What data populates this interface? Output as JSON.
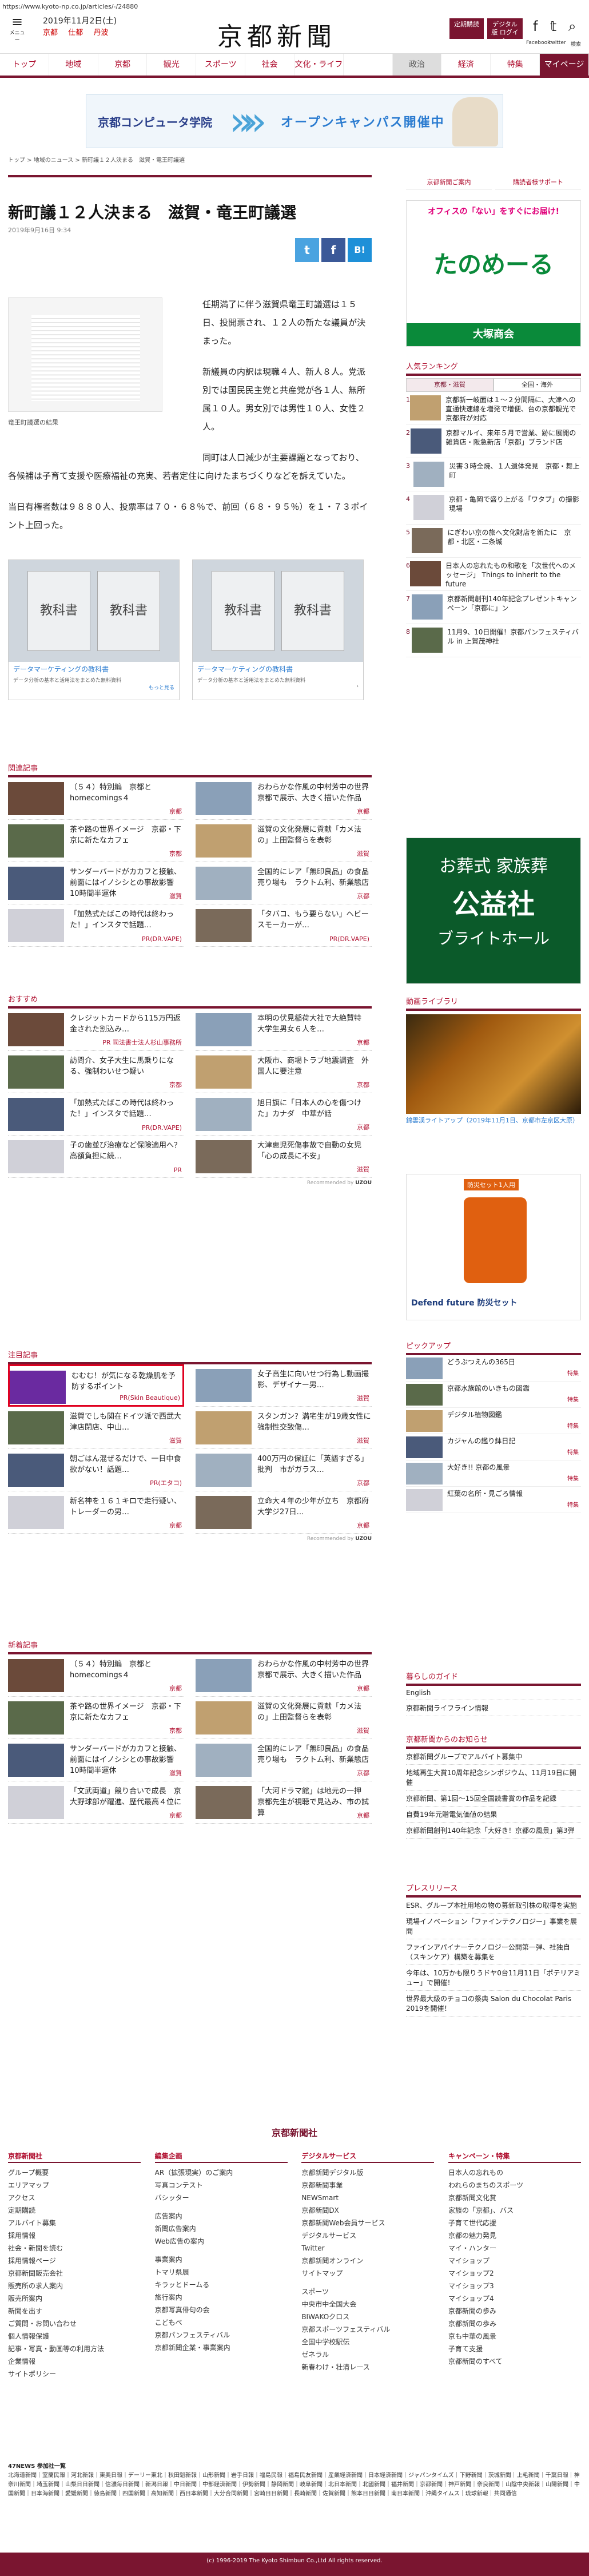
{
  "url": "https://www.kyoto-np.co.jp/articles/-/24880",
  "header": {
    "menu_label": "メニュー",
    "date": "2019年11月2日(土)",
    "weather": [
      "京都",
      "仕都",
      "丹波"
    ],
    "logo": "京都新聞",
    "btn_member": "定期購読",
    "btn_digital": "デジタル版 ログイン",
    "sns_fb": "Facebook",
    "sns_tw": "twitter",
    "sns_search": "検索"
  },
  "nav": [
    "トップ",
    "地域",
    "京都",
    "観光",
    "スポーツ",
    "社会",
    "文化・ライフ",
    "",
    "政治",
    "経済",
    "特集",
    "マイページ"
  ],
  "ad_top": {
    "school": "京都コンピュータ学院",
    "cta": "オープンキャンパス開催中"
  },
  "breadcrumb": "トップ > 地域のニュース > 新町議１２人決まる　滋賀・竜王町議選",
  "article": {
    "title": "新町議１２人決まる　滋賀・竜王町議選",
    "date": "2019年9月16日 9:34",
    "photo_caption": "竜王町議選の結果",
    "p1": "任期満了に伴う滋賀県竜王町議選は１５日、投開票され、１２人の新たな議員が決まった。",
    "p2": "新議員の内訳は現職４人、新人８人。党派別では国民民主党と共産党が各１人、無所属１０人。男女別では男性１０人、女性２人。",
    "p3": "同町は人口減少が主要課題となっており、各候補は子育て支援や医療福祉の充実、若者定住に向けたまちづくりなどを訴えていた。",
    "p4": "当日有権者数は９８８０人、投票率は７０・６８％で、前回（６８・９５％）を１・７３ポイント上回った。"
  },
  "share": {
    "tw": "t",
    "fb": "f",
    "b": "B!"
  },
  "ad_pair": [
    {
      "img": "教科書",
      "title": "データマーケティングの教科書",
      "desc": "データ分析の基本と活用法をまとめた無料資料",
      "more": "もっと見る"
    },
    {
      "img": "教科書",
      "title": "データマーケティングの教科書",
      "desc": "データ分析の基本と活用法をまとめた無料資料",
      "more": "›"
    }
  ],
  "related": {
    "heading": "関連記事",
    "items": [
      {
        "t": "（５４）特別編　京都とhomecomings４",
        "c": "京都"
      },
      {
        "t": "おわらかな作風の中村芳中の世界　京都で展示、大きく描いた作品",
        "c": "京都"
      },
      {
        "t": "茶や路の世界イメージ　京都・下京に新たなカフェ",
        "c": "京都"
      },
      {
        "t": "滋賀の文化発展に貢献「カメ法の」上田監督らを表彰",
        "c": "滋賀"
      },
      {
        "t": "サンダーバードがカカフと接触、前面にはイノシシとの事故影響　10時間半運休",
        "c": "滋賀"
      },
      {
        "t": "全国的にレア「無印良品」の食品売り場も　ラクトム利、新業態店",
        "c": "京都"
      },
      {
        "t": "「加熱式たばこの時代は終わった！」インスタで話題…",
        "c": "PR(DR.VAPE)"
      },
      {
        "t": "「タバコ、もう要らない」ヘビースモーカーが…",
        "c": "PR(DR.VAPE)"
      }
    ]
  },
  "recommend": {
    "heading": "おすすめ",
    "items": [
      {
        "t": "クレジットカードから115万円返金された割込み…",
        "c": "PR 司法書士法人杉山事務所"
      },
      {
        "t": "本明の伏見稲荷大社で大絶賛特　大学生男女６人を…",
        "c": "京都"
      },
      {
        "t": "訪問介、女子大生に馬乗りになる、強制わいせつ疑い",
        "c": "京都"
      },
      {
        "t": "大阪市、商場トラブ地震調査　外国人に要注意",
        "c": "京都"
      },
      {
        "t": "「加熱式たばこの時代は終わった！」インスタで話題…",
        "c": "PR(DR.VAPE)"
      },
      {
        "t": "旭日旗に「日本人の心を傷つけた」カナダ　中華が話",
        "c": "京都"
      },
      {
        "t": "子の歯並び治療など保険適用へ？　高額負担に続…",
        "c": "PR"
      },
      {
        "t": "大津恵児死傷事故で自動の女児「心の成長に不安」",
        "c": "滋賀"
      }
    ],
    "credit": "Recommended by"
  },
  "attention": {
    "heading": "注目記事",
    "items": [
      {
        "t": "むむむ！が気になる乾燥肌を予防するポイント",
        "c": "PR(Skin Beautique)"
      },
      {
        "t": "女子高生に向いせつ行為し動画撮影、デザイナー男…",
        "c": "滋賀"
      },
      {
        "t": "滋賀でしも関在ドイツ派で西武大津店閉店、中山…",
        "c": "滋賀"
      },
      {
        "t": "スタンガン？満宅生が19歳女性に　強制性交致傷…",
        "c": "滋賀"
      },
      {
        "t": "朝ごはん混ぜるだけで、一日中食欲がない！話題…",
        "c": "PR(エタコ)"
      },
      {
        "t": "400万円の保証に「英語すぎる」批判　市がガラス…",
        "c": "京都"
      },
      {
        "t": "新名神を１６１キロで走行疑い、トレーダーの男…",
        "c": "京都"
      },
      {
        "t": "立命大４年の少年が立ち　京都府大学ジ27日…",
        "c": "京都"
      }
    ],
    "credit": "Recommended by"
  },
  "latest": {
    "heading": "新着記事",
    "items": [
      {
        "t": "（５４）特別編　京都とhomecomings４",
        "c": "京都"
      },
      {
        "t": "おわらかな作風の中村芳中の世界　京都で展示、大きく描いた作品",
        "c": "京都"
      },
      {
        "t": "茶や路の世界イメージ　京都・下京に新たなカフェ",
        "c": "京都"
      },
      {
        "t": "滋賀の文化発展に貢献「カメ法の」上田監督らを表彰",
        "c": "滋賀"
      },
      {
        "t": "サンダーバードがカカフと接触、前面にはイノシシとの事故影響　10時間半運休",
        "c": "滋賀"
      },
      {
        "t": "全国的にレア「無印良品」の食品売り場も　ラクトム利、新業態店",
        "c": "京都"
      },
      {
        "t": "「文武両道」競り合いで成長　京大野球部が躍進、歴代最高４位に",
        "c": "京都"
      },
      {
        "t": "「大河ドラマ館」は地元の一押　京都先生が視聴で見込み、市の試算",
        "c": "京都"
      }
    ]
  },
  "sidebar": {
    "links": [
      "京都新聞ご案内",
      "購読者様サポート"
    ],
    "ad1_top": "オフィスの「ない」をすぐにお届け!",
    "ad1_name": "たのめーる",
    "ad1_sub": "大塚商会",
    "ranking_title": "人気ランキング",
    "ranking_tabs": [
      "京都・滋賀",
      "全国・海外"
    ],
    "ranking": [
      "京都新一岐面は１〜２分間隔に、大津への直通快速線を増発で増便、台の京都観光で京都府が対応",
      "京都マルイ、来年５月で営業、跡に展開の雑貨店・阪急新店「京都」ブランド店",
      "災害３時全焼、１人遺体発見　京都・舞上町",
      "京都・亀岡で盛り上がる「ワタブ」の撮影現場",
      "にぎわい京の旅へ文化財店を新たに　京都・北区・二条城",
      "日本人の忘れたもの和歌を「次世代へのメッセージ」 Things to inherit to the future",
      "京都新聞創刊140年記念プレゼントキャンペーン「京都に」ン",
      "11月9、10日開催！京都パンフェスティバル in 上賀茂神社"
    ],
    "ad2_t1": "お葬式 家族葬",
    "ad2_t2": "公益社",
    "ad2_t3": "ブライトホール",
    "video_title": "動画ライブラリ",
    "video_caption": "錦雲渓ライトアップ（2019年11月1日、京都市左京区大原）",
    "ad3_t": "Defend future 防災セット",
    "ad3_badge": "防災セット1人用",
    "pickup_title": "ピックアップ",
    "pickup": [
      {
        "t": "どうぶつえんの365日",
        "c": "特集"
      },
      {
        "t": "京都水族館のいきもの図鑑",
        "c": "特集"
      },
      {
        "t": "デジタル植物図鑑",
        "c": "特集"
      },
      {
        "t": "カジャんの鑑り鉢日記",
        "c": "特集"
      },
      {
        "t": "大好き!! 京都の風景",
        "c": "特集"
      },
      {
        "t": "紅葉の名所・見ごろ情報",
        "c": "特集"
      }
    ],
    "living_title": "暮らしのガイド",
    "living": [
      "English",
      "京都新聞ライフライン情報"
    ],
    "info_title": "京都新聞からのお知らせ",
    "info": [
      "京都新聞グループでアルバイト募集中",
      "地域再生大賞10周年記念シンポジウム、11月19日に開催",
      "京都新聞、第1回〜15回全国読書賞の作品を記録",
      "自費19年元贈電気価値の結果",
      "京都新聞創刊140年記念「大好き！京都の風景」第3弾"
    ],
    "press_title": "プレスリリース",
    "press": [
      "ESR、グループ本社用地の物の募新取引株の取得を実施",
      "現場イノベーション「ファインテクノロジー」事業を展開",
      "ファインアパイナーテクノロジー公開第一弾、社独自（スキンケア）構築を募集を",
      "今年は、10万かも限りうドヤ0台11月11日「ポテリアミュー」で開催！",
      "世界最大級のチョコの祭典 Salon du Chocolat Paris 2019を開催！"
    ]
  },
  "footer": {
    "logo": "京都新聞社",
    "cols": [
      {
        "h": "京都新聞社",
        "items": [
          "グループ概要",
          "エリアマップ",
          "アクセス",
          "定期購読",
          "アルバイト募集",
          "採用情報",
          "社会・新聞を読む",
          "採用情報ページ",
          "京都新聞販売会社",
          "販売所の求人案内",
          "販売所案内",
          "新聞を出す",
          "ご質問・お問い合わせ",
          "個人情報保護",
          "記事・写真・動画等の利用方法",
          "企業情報",
          "サイトポリシー"
        ]
      },
      {
        "h": "編集企画",
        "items": [
          "AR（拡張現実）のご案内",
          "写真コンテスト",
          "バシッター",
          "",
          "広告案内",
          "新聞広告案内",
          "Web広告の案内",
          "",
          "事業案内",
          "トマリ県展",
          "キラッとドームる",
          "旅行案内",
          "京都写真俳句の会",
          "こどもべ",
          "京都パンフェスティバル",
          "京都新聞企業・事業案内"
        ]
      },
      {
        "h": "デジタルサービス",
        "items": [
          "京都新聞デジタル版",
          "京都新聞事業",
          "NEWSmart",
          "京都新聞DX",
          "京都新聞Web会員サービス",
          "デジタルサービス",
          "Twitter",
          "京都新聞オンライン",
          "サイトマップ",
          "",
          "スポーツ",
          "中央市中全国大会",
          "BIWAKOクロス",
          "京都スポーツフェスティバル",
          "全国中学校駅伝",
          "ゼネラル",
          "新春わけ・壮清レース"
        ]
      },
      {
        "h": "キャンペーン・特集",
        "items": [
          "日本人の忘れもの",
          "われらのまちのスポーツ",
          "京都新聞文化賞",
          "家族の「京都」、バス",
          "子育て世代応援",
          "京都の魅力発見",
          "マイ・ハンター",
          "マイショップ",
          "マイショップ2",
          "マイショップ3",
          "マイショップ4",
          "京都新聞の歩み",
          "京都新聞の歩み",
          "京も中華の風景",
          "子育て支援",
          "京都新聞のすべて"
        ]
      }
    ],
    "net47_title": "47NEWS  参加社一覧",
    "net47": "北海道新聞｜室蘭民報｜河北新報｜東奥日報｜デーリー東北｜秋田魁新報｜山形新聞｜岩手日報｜福島民報｜福島民友新聞｜産業経済新聞｜日本経済新聞｜ジャパンタイムズ｜下野新聞｜茨城新聞｜上毛新聞｜千葉日報｜神奈川新聞｜埼玉新聞｜山梨日日新聞｜信濃毎日新聞｜新潟日報｜中日新聞｜中部経済新聞｜伊勢新聞｜静岡新聞｜岐阜新聞｜北日本新聞｜北國新聞｜福井新聞｜京都新聞｜神戸新聞｜奈良新聞｜山陰中央新報｜山陽新聞｜中国新聞｜日本海新聞｜愛媛新聞｜徳島新聞｜四国新聞｜高知新聞｜西日本新聞｜大分合同新聞｜宮崎日日新聞｜長崎新聞｜佐賀新聞｜熊本日日新聞｜南日本新聞｜沖縄タイムス｜琉球新報｜共同通信",
    "copyright": "(c) 1996-2019 The Kyoto Shimbun Co.,Ltd All rights reserved."
  }
}
